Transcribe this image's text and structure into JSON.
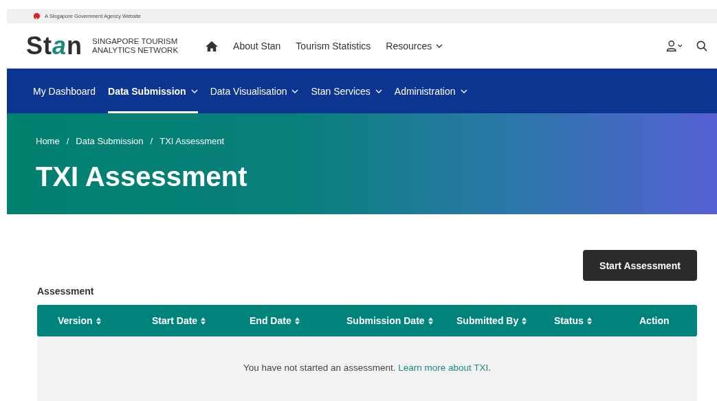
{
  "gov_bar": {
    "text": "A Singapore Government Agency Website"
  },
  "header": {
    "logo": "Stan",
    "tagline": [
      "SINGAPORE TOURISM",
      "ANALYTICS NETWORK"
    ],
    "links": [
      {
        "label": "About Stan",
        "dropdown": false
      },
      {
        "label": "Tourism Statistics",
        "dropdown": false
      },
      {
        "label": "Resources",
        "dropdown": true
      }
    ]
  },
  "nav": [
    {
      "label": "My Dashboard",
      "selected": false,
      "dropdown": false
    },
    {
      "label": "Data Submission",
      "selected": true,
      "dropdown": true
    },
    {
      "label": "Data Visualisation",
      "selected": false,
      "dropdown": true
    },
    {
      "label": "Stan Services",
      "selected": false,
      "dropdown": true
    },
    {
      "label": "Administration",
      "selected": false,
      "dropdown": true
    }
  ],
  "breadcrumbs": [
    "Home",
    "Data Submission",
    "TXI Assessment"
  ],
  "breadcrumb_separator": "/",
  "page_title": "TXI Assessment",
  "start_button": "Start Assessment",
  "table": {
    "title": "Assessment",
    "columns": [
      {
        "label": "Version",
        "sortable": true
      },
      {
        "label": "Start Date",
        "sortable": true
      },
      {
        "label": "End Date",
        "sortable": true
      },
      {
        "label": "Submission Date",
        "sortable": true
      },
      {
        "label": "Submitted By",
        "sortable": true
      },
      {
        "label": "Status",
        "sortable": true
      },
      {
        "label": "Action",
        "sortable": false
      }
    ],
    "empty_message": "You have not started an assessment.",
    "empty_link": "Learn more about TXI",
    "empty_end": "."
  }
}
